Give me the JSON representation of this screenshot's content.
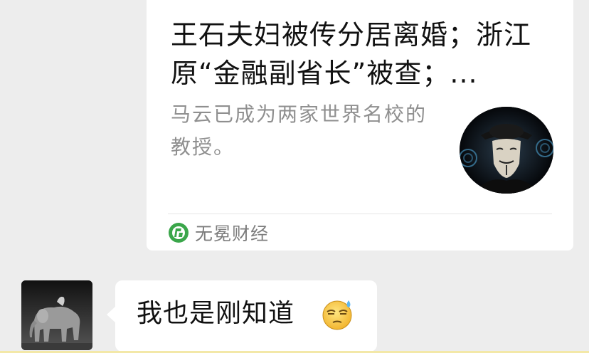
{
  "link_card": {
    "title": "王石夫妇被传分居离婚；浙江原“金融副省长”被查；...",
    "description": "马云已成为两家世界名校的教授。",
    "source": "无冕财经",
    "thumbnail": "masked-face-thumbnail",
    "source_icon": "wumian-caijing-logo-icon"
  },
  "message": {
    "text": "我也是刚知道",
    "emoji": "sweating-face-emoji",
    "avatar": "elephant-avatar"
  },
  "colors": {
    "background": "#ededed",
    "bubble": "#ffffff",
    "title_text": "#111111",
    "secondary_text": "#8f8f8f",
    "source_icon_green": "#3aa64a"
  }
}
